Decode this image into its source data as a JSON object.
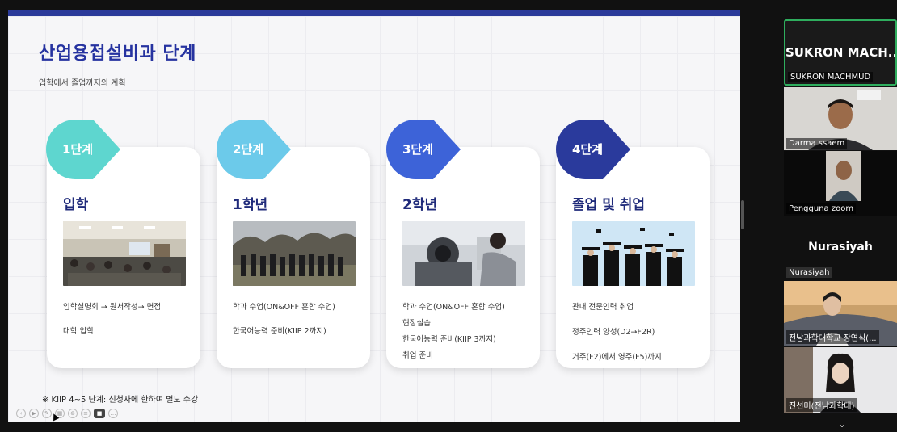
{
  "slide": {
    "title": "산업용접설비과 단계",
    "subtitle": "입학에서 졸업까지의 계획",
    "footnote": "※ KIIP 4~5 단계: 신청자에 한하여 별도 수강",
    "stages": [
      {
        "badge": "1단계",
        "heading": "입학",
        "color": "#5ed6cf",
        "lines": [
          "입학설명회 → 원서작성→ 면접",
          "대학 입학"
        ]
      },
      {
        "badge": "2단계",
        "heading": "1학년",
        "color": "#6ccaea",
        "lines": [
          "학과 수업(ON&OFF 혼합 수업)",
          "한국어능력 준비(KIIP 2까지)"
        ]
      },
      {
        "badge": "3단계",
        "heading": "2학년",
        "color": "#3d63d8",
        "lines": [
          "학과 수업(ON&OFF 혼합 수업)",
          "현장실습",
          "한국어능력 준비(KIIP 3까지)",
          "취업 준비"
        ]
      },
      {
        "badge": "4단계",
        "heading": "졸업 및 취업",
        "color": "#2a3a9c",
        "lines": [
          "관내 전문인력 취업",
          "정주인력 양성(D2→F2R)",
          "거주(F2)에서 영주(F5)까지"
        ]
      }
    ]
  },
  "participants": {
    "active_speaker": {
      "big_name": "SUKRON  MACH...",
      "label": "SUKRON MACHMUD"
    },
    "tiles": [
      {
        "label": "Darma ssaem"
      },
      {
        "label": "Pengguna zoom"
      },
      {
        "big_name": "Nurasiyah",
        "label": "Nurasiyah"
      },
      {
        "label": "전남과학대학교 장연식(..."
      },
      {
        "label": "진선미(전남과학대)"
      }
    ]
  },
  "colors": {
    "accent": "#2633a0",
    "active_border": "#2fae5e"
  },
  "icons": [
    "chevron-down-icon"
  ]
}
